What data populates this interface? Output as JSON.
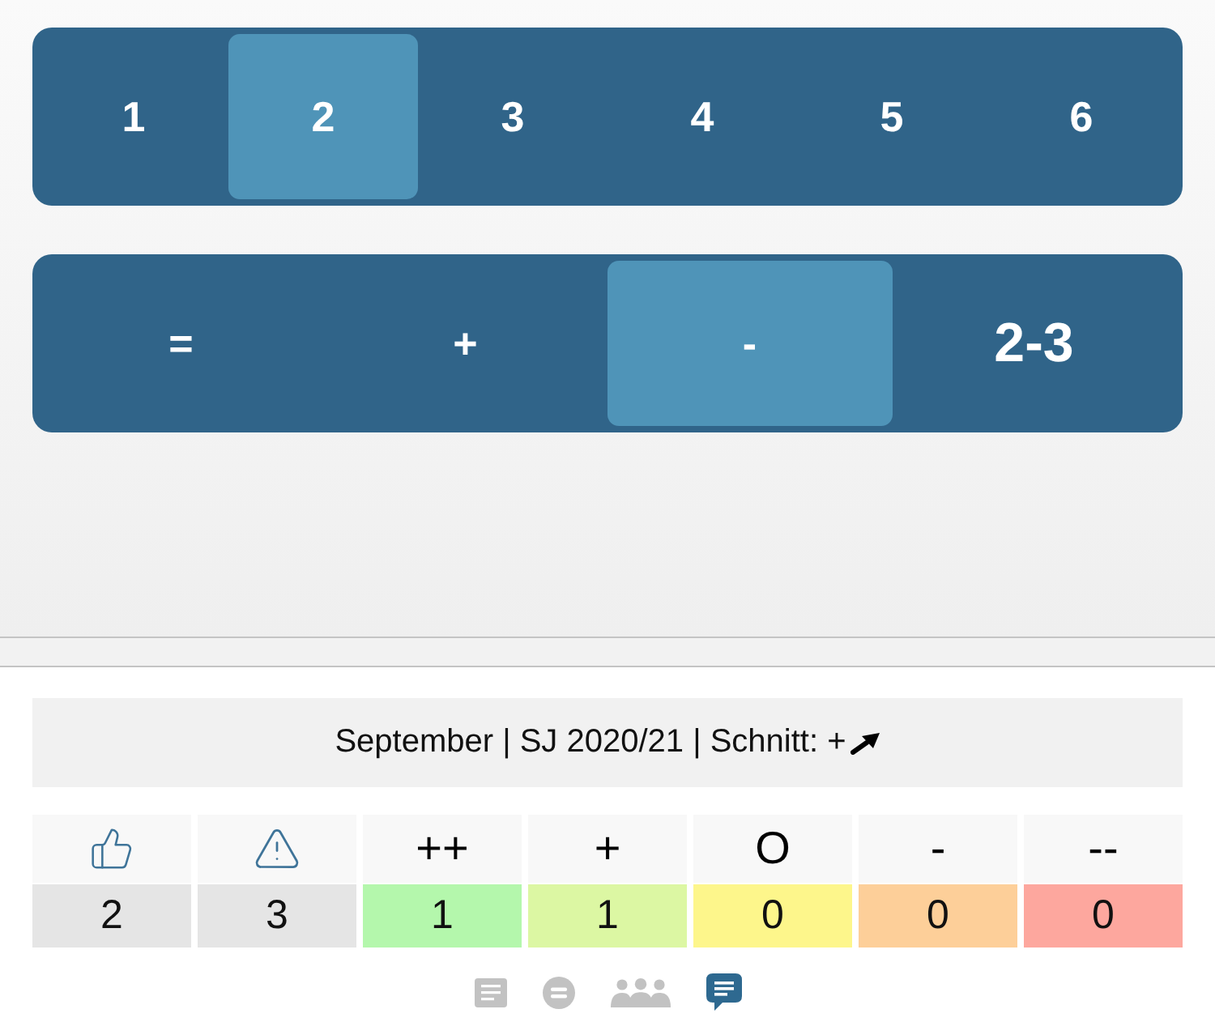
{
  "grade_selector": {
    "options": [
      {
        "label": "1",
        "selected": false
      },
      {
        "label": "2",
        "selected": true
      },
      {
        "label": "3",
        "selected": false
      },
      {
        "label": "4",
        "selected": false
      },
      {
        "label": "5",
        "selected": false
      },
      {
        "label": "6",
        "selected": false
      }
    ]
  },
  "trend_selector": {
    "options": [
      {
        "label": "=",
        "kind": "symbol",
        "selected": false
      },
      {
        "label": "+",
        "kind": "symbol",
        "selected": false
      },
      {
        "label": "-",
        "kind": "symbol",
        "selected": true
      },
      {
        "label": "2-3",
        "kind": "range",
        "selected": false
      }
    ]
  },
  "summary": {
    "text": "September | SJ 2020/21 | Schnitt: +"
  },
  "tally": {
    "columns": [
      {
        "kind": "praise",
        "value": "2",
        "color": "#e5e5e5"
      },
      {
        "kind": "warning",
        "value": "3",
        "color": "#e5e5e5"
      },
      {
        "kind": "grade",
        "header": "++",
        "value": "1",
        "color": "#b4f7ac"
      },
      {
        "kind": "grade",
        "header": "+",
        "value": "1",
        "color": "#dcf7a3"
      },
      {
        "kind": "grade",
        "header": "O",
        "value": "0",
        "color": "#fdf68b"
      },
      {
        "kind": "grade",
        "header": "-",
        "value": "0",
        "color": "#fdcf99"
      },
      {
        "kind": "grade",
        "header": "--",
        "value": "0",
        "color": "#fda79e"
      }
    ]
  },
  "bottom_nav": {
    "items": [
      {
        "kind": "document",
        "selected": false
      },
      {
        "kind": "equals",
        "selected": false
      },
      {
        "kind": "people",
        "selected": false
      },
      {
        "kind": "chat",
        "selected": true
      }
    ]
  }
}
